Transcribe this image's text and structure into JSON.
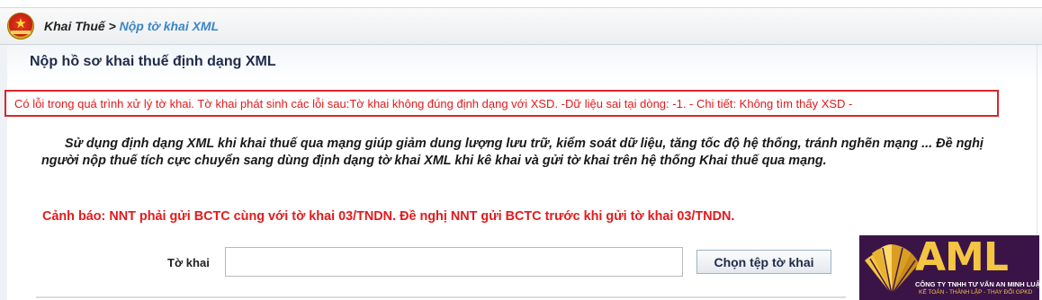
{
  "breadcrumb": {
    "home": "Khai Thuế",
    "separator": ">",
    "current": "Nộp tờ khai XML"
  },
  "page": {
    "title": "Nộp hồ sơ khai thuế định dạng XML"
  },
  "error": {
    "message": "Có lỗi trong quá trình xử lý tờ khai. Tờ khai phát sinh các lỗi sau:Tờ khai không đúng định dạng với XSD. -Dữ liệu sai tại dòng: -1. - Chi tiết: Không tìm thấy XSD -"
  },
  "info": {
    "text": "Sử dụng định dạng XML khi khai thuế qua mạng giúp giảm dung lượng lưu trữ, kiểm soát dữ liệu, tăng tốc độ hệ thống, tránh nghẽn mạng ... Đề nghị người nộp thuế tích cực chuyển sang dùng định dạng tờ khai XML khi kê khai và gửi tờ khai trên hệ thống Khai thuế qua mạng."
  },
  "warning": {
    "text": "Cảnh báo: NNT phải gửi BCTC cùng với tờ khai 03/TNDN. Đề nghị NNT gửi BCTC trước khi gửi tờ khai 03/TNDN."
  },
  "form": {
    "field_label": "Tờ khai",
    "file_value": "",
    "choose_button": "Chọn tệp tờ khai"
  },
  "watermark": {
    "brand": "AML",
    "company": "CÔNG TY TNHH TƯ VẤN AN MINH LUẬT",
    "services": "KẾ TOÁN - THÀNH LẬP - THAY ĐỔI GPKD"
  },
  "colors": {
    "error_red": "#e31a1c",
    "link_blue": "#3a86c8",
    "title_navy": "#1e2b4a",
    "logo_purple": "#3a1447",
    "logo_gold": "#f4c542"
  }
}
